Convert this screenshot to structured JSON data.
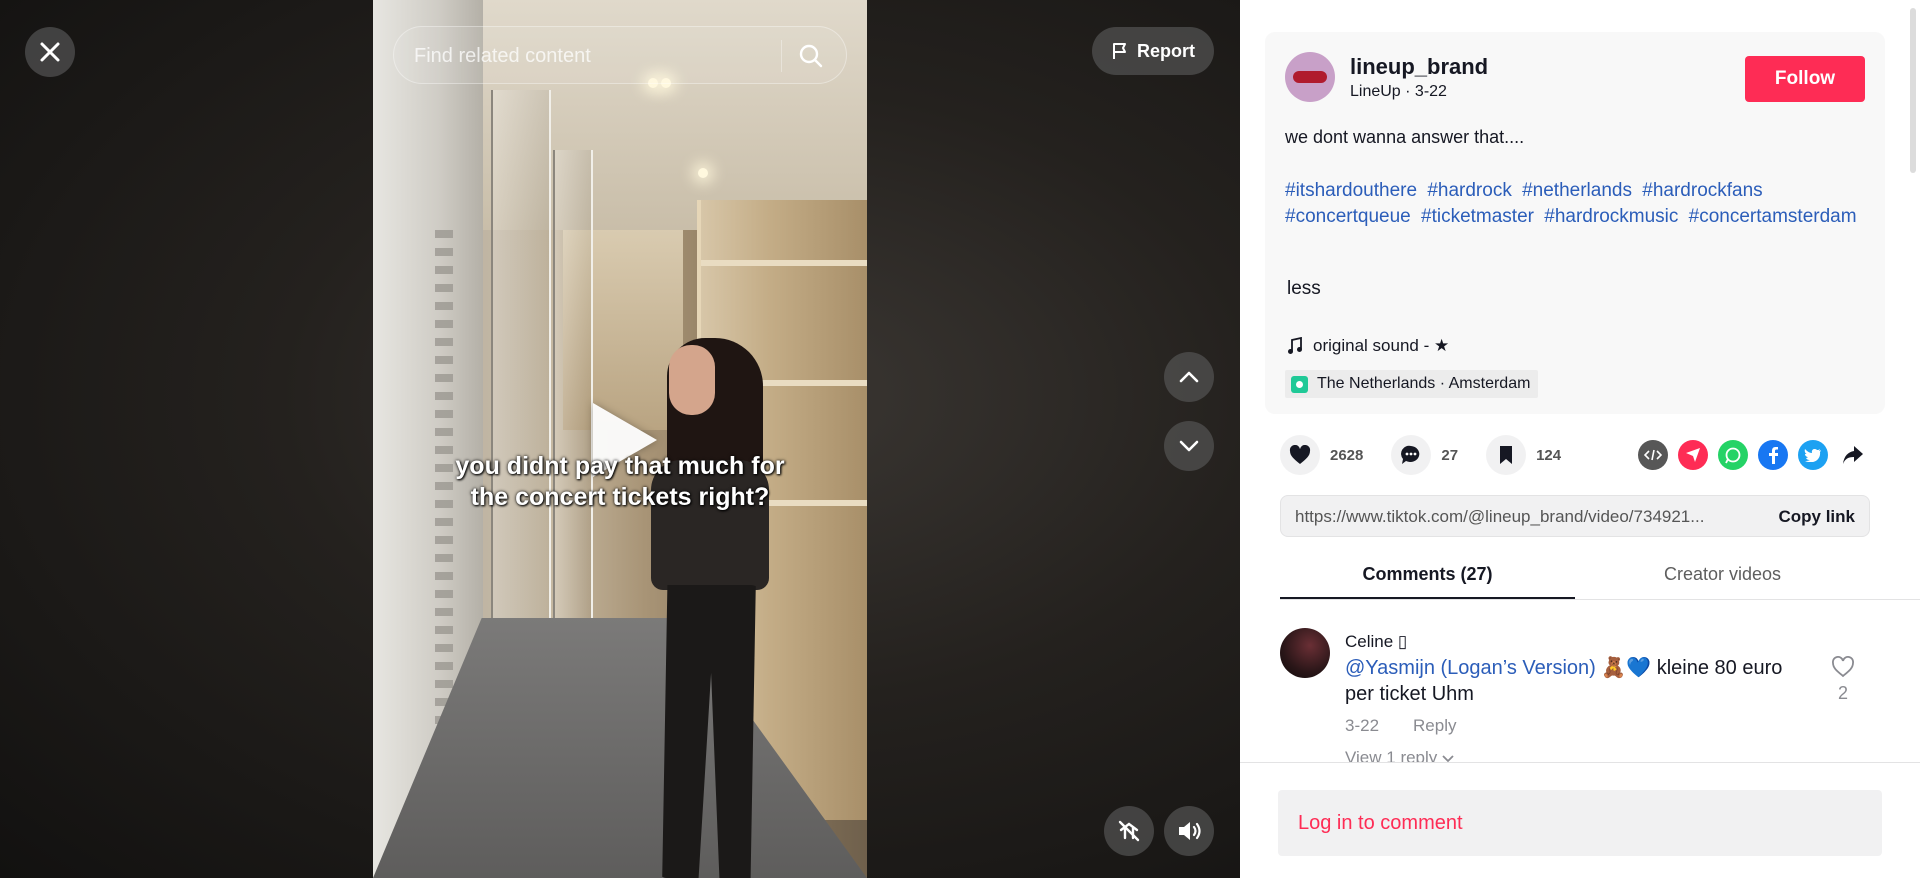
{
  "search": {
    "placeholder": "Find related content"
  },
  "report_label": "Report",
  "video": {
    "caption_line1": "you didnt pay that much for",
    "caption_line2": "the concert tickets right?"
  },
  "post": {
    "username": "lineup_brand",
    "nickname_date": "LineUp · 3-22",
    "follow_label": "Follow",
    "description": "we dont wanna answer that....",
    "hashtags": [
      "#itshardouthere",
      "#hardrock",
      "#netherlands",
      "#hardrockfans",
      "#concertqueue",
      "#ticketmaster",
      "#hardrockmusic",
      "#concertamsterdam"
    ],
    "less_label": "less",
    "sound": "original sound - ★",
    "location": "The Netherlands · Amsterdam"
  },
  "stats": {
    "likes": "2628",
    "comments": "27",
    "saves": "124"
  },
  "share_link": {
    "url": "https://www.tiktok.com/@lineup_brand/video/734921...",
    "copy_label": "Copy link"
  },
  "tabs": {
    "comments": "Comments (27)",
    "creator_videos": "Creator videos"
  },
  "comment": {
    "user": "Celine ▯",
    "mention": "@Yasmijn (Logan’s Version)",
    "text": " 🧸💙 kleine 80 euro per ticket Uhm",
    "date": "3-22",
    "reply_label": "Reply",
    "view_replies": "View 1 reply",
    "likes": "2"
  },
  "login_label": "Log in to comment",
  "colors": {
    "accent": "#fe2c55",
    "hashtag": "#2b5db9"
  },
  "icons": [
    "close-icon",
    "search-icon",
    "flag-icon",
    "chevron-up-icon",
    "chevron-down-icon",
    "play-icon",
    "floating-player-icon",
    "volume-icon",
    "heart-icon",
    "comment-icon",
    "bookmark-icon",
    "embed-icon",
    "send-icon",
    "whatsapp-icon",
    "facebook-icon",
    "twitter-icon",
    "share-arrow-icon",
    "music-note-icon",
    "location-icon"
  ]
}
